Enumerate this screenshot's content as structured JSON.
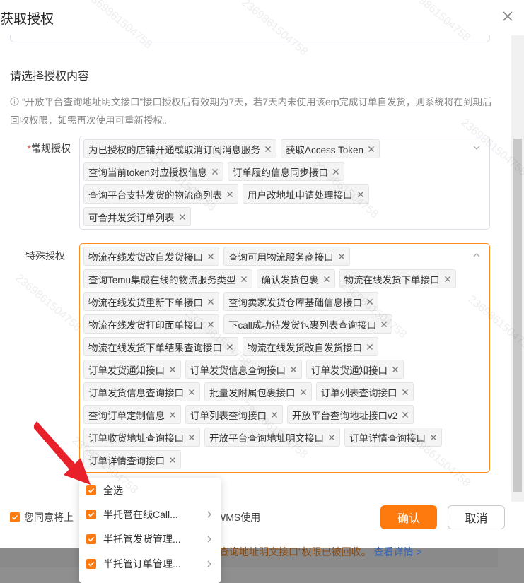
{
  "dialog": {
    "title": "获取授权",
    "section_title": "请选择授权内容",
    "notice": "“开放平台查询地址明文接口”接口授权后有效期为7天，若7天内未使用该erp完成订单自发货，则系统将在到期后回收权限，如需再次使用可重新授权。"
  },
  "regular": {
    "required_mark": "*",
    "label": "常规授权",
    "tags": [
      "为已授权的店铺开通或取消订阅消息服务",
      "获取Access Token",
      "查询当前token对应授权信息",
      "订单履约信息同步接口",
      "查询平台支持发货的物流商列表",
      "用户改地址申请处理接口",
      "可合并发货订单列表"
    ]
  },
  "special": {
    "label": "特殊授权",
    "tags": [
      "物流在线发货改自发货接口",
      "查询可用物流服务商接口",
      "查询Temu集成在线的物流服务类型",
      "确认发货包裹",
      "物流在线发货下单接口",
      "物流在线发货重新下单接口",
      "查询卖家发货仓库基础信息接口",
      "物流在线发货打印面单接口",
      "下call成功待发货包裹列表查询接口",
      "物流在线发货下单结果查询接口",
      "物流在线发货改自发货接口",
      "订单发货通知接口",
      "订单发货信息查询接口",
      "订单发货通知接口",
      "订单发货信息查询接口",
      "批量发附属包裹接口",
      "订单列表查询接口",
      "查询订单定制信息",
      "订单列表查询接口",
      "开放平台查询地址接口v2",
      "订单收货地址查询接口",
      "开放平台查询地址明文接口",
      "订单详情查询接口",
      "订单详情查询接口"
    ]
  },
  "dropdown": {
    "items": [
      {
        "label": "全选",
        "has_arrow": false
      },
      {
        "label": "半托管在线Call...",
        "has_arrow": true
      },
      {
        "label": "半托管发货管理...",
        "has_arrow": true
      },
      {
        "label": "半托管订单管理...",
        "has_arrow": true
      }
    ]
  },
  "footer": {
    "agree_prefix": "您同意将上",
    "agree_suffix": "理WMS使用",
    "confirm_label": "确认",
    "cancel_label": "取消"
  },
  "background_note": {
    "text": "查询地址明文接口”权限已被回收。",
    "link": "查看详情 >"
  },
  "watermark": "2369861504758",
  "colors": {
    "accent": "#ff7a0e",
    "required": "#e5483a",
    "pointer_arrow": "#e8202a"
  }
}
